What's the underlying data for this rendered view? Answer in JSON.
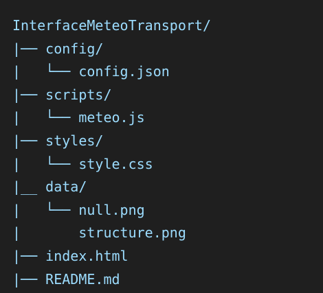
{
  "tree": {
    "lines": [
      {
        "prefix": "",
        "name": "InterfaceMeteoTransport/"
      },
      {
        "prefix": "|── ",
        "name": "config/"
      },
      {
        "prefix": "|   └── ",
        "name": "config.json"
      },
      {
        "prefix": "|── ",
        "name": "scripts/"
      },
      {
        "prefix": "|   └── ",
        "name": "meteo.js"
      },
      {
        "prefix": "|── ",
        "name": "styles/"
      },
      {
        "prefix": "|   └── ",
        "name": "style.css"
      },
      {
        "prefix": "|__ ",
        "name": "data/"
      },
      {
        "prefix": "|   └── ",
        "name": "null.png"
      },
      {
        "prefix": "|       ",
        "name": "structure.png"
      },
      {
        "prefix": "|── ",
        "name": "index.html"
      },
      {
        "prefix": "|── ",
        "name": "README.md"
      }
    ]
  }
}
